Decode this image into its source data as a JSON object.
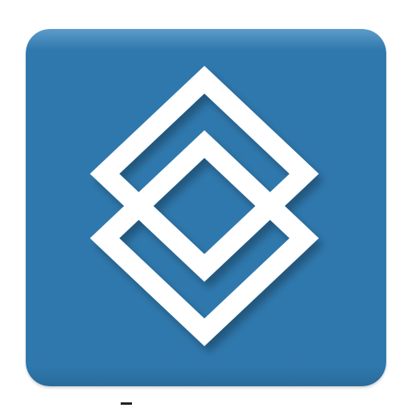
{
  "app_icon": {
    "icon_name": "double-diamond-logo-icon",
    "background_color": "#2f78ad",
    "top_highlight_color": "#5d9cc9",
    "bottom_shade_color": "#2a6c9c",
    "glyph_color": "#ffffff"
  }
}
